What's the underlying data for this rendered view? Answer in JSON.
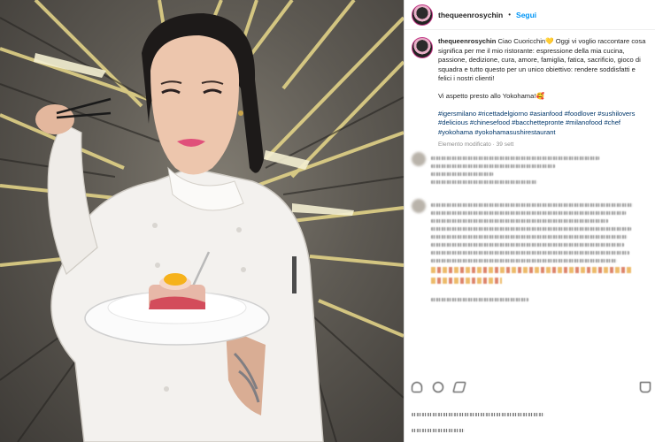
{
  "post": {
    "username": "thequeenrosychin",
    "separator": "•",
    "follow_label": "Segui",
    "caption_username": "thequeenrosychin",
    "caption_text": "Ciao Cuoricchin💛 Oggi vi voglio raccontare cosa significa per me il mio ristorante: espressione della mia cucina, passione, dedizione, cura, amore, famiglia, fatica, sacrificio, gioco di squadra e tutto questo per un unico obiettivo: rendere soddisfatti e felici i nostri clienti!",
    "cta": "Vi aspetto presto allo Yokohama!🥰",
    "hashtags": "#igersmilano #ricettadelgiorno #asianfood #foodlover #sushilovers #delicious #chinesefood #bacchettepronte #milanofood #chef #yokohama #yokohamasushirestaurant",
    "edited_label": "Elemento modificato · 39 sett"
  },
  "icons": {
    "avatar": "profile-avatar",
    "like": "heart-icon",
    "comment": "comment-icon",
    "share": "share-icon",
    "bookmark": "bookmark-icon"
  },
  "colors": {
    "follow_blue": "#0095f6",
    "hashtag_blue": "#00376b",
    "avatar_ring": "#c13584"
  }
}
